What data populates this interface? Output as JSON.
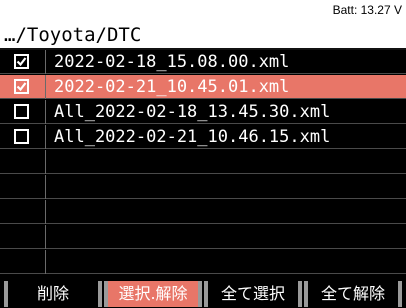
{
  "status": {
    "battery": "Batt: 13.27 V"
  },
  "path": "…/Toyota/DTC",
  "files": [
    {
      "name": "2022-02-18_15.08.00.xml",
      "checked": true,
      "selected": false
    },
    {
      "name": "2022-02-21_10.45.01.xml",
      "checked": true,
      "selected": true
    },
    {
      "name": "All_2022-02-18_13.45.30.xml",
      "checked": false,
      "selected": false
    },
    {
      "name": "All_2022-02-21_10.46.15.xml",
      "checked": false,
      "selected": false
    }
  ],
  "empty_rows": 5,
  "toolbar": {
    "buttons": [
      {
        "label": "削除",
        "active": false
      },
      {
        "label": "選択.解除",
        "active": true
      },
      {
        "label": "全て選択",
        "active": false
      },
      {
        "label": "全て解除",
        "active": false
      }
    ]
  },
  "colors": {
    "selected_row": "#e87668",
    "button_border": "#9a9a9a"
  }
}
